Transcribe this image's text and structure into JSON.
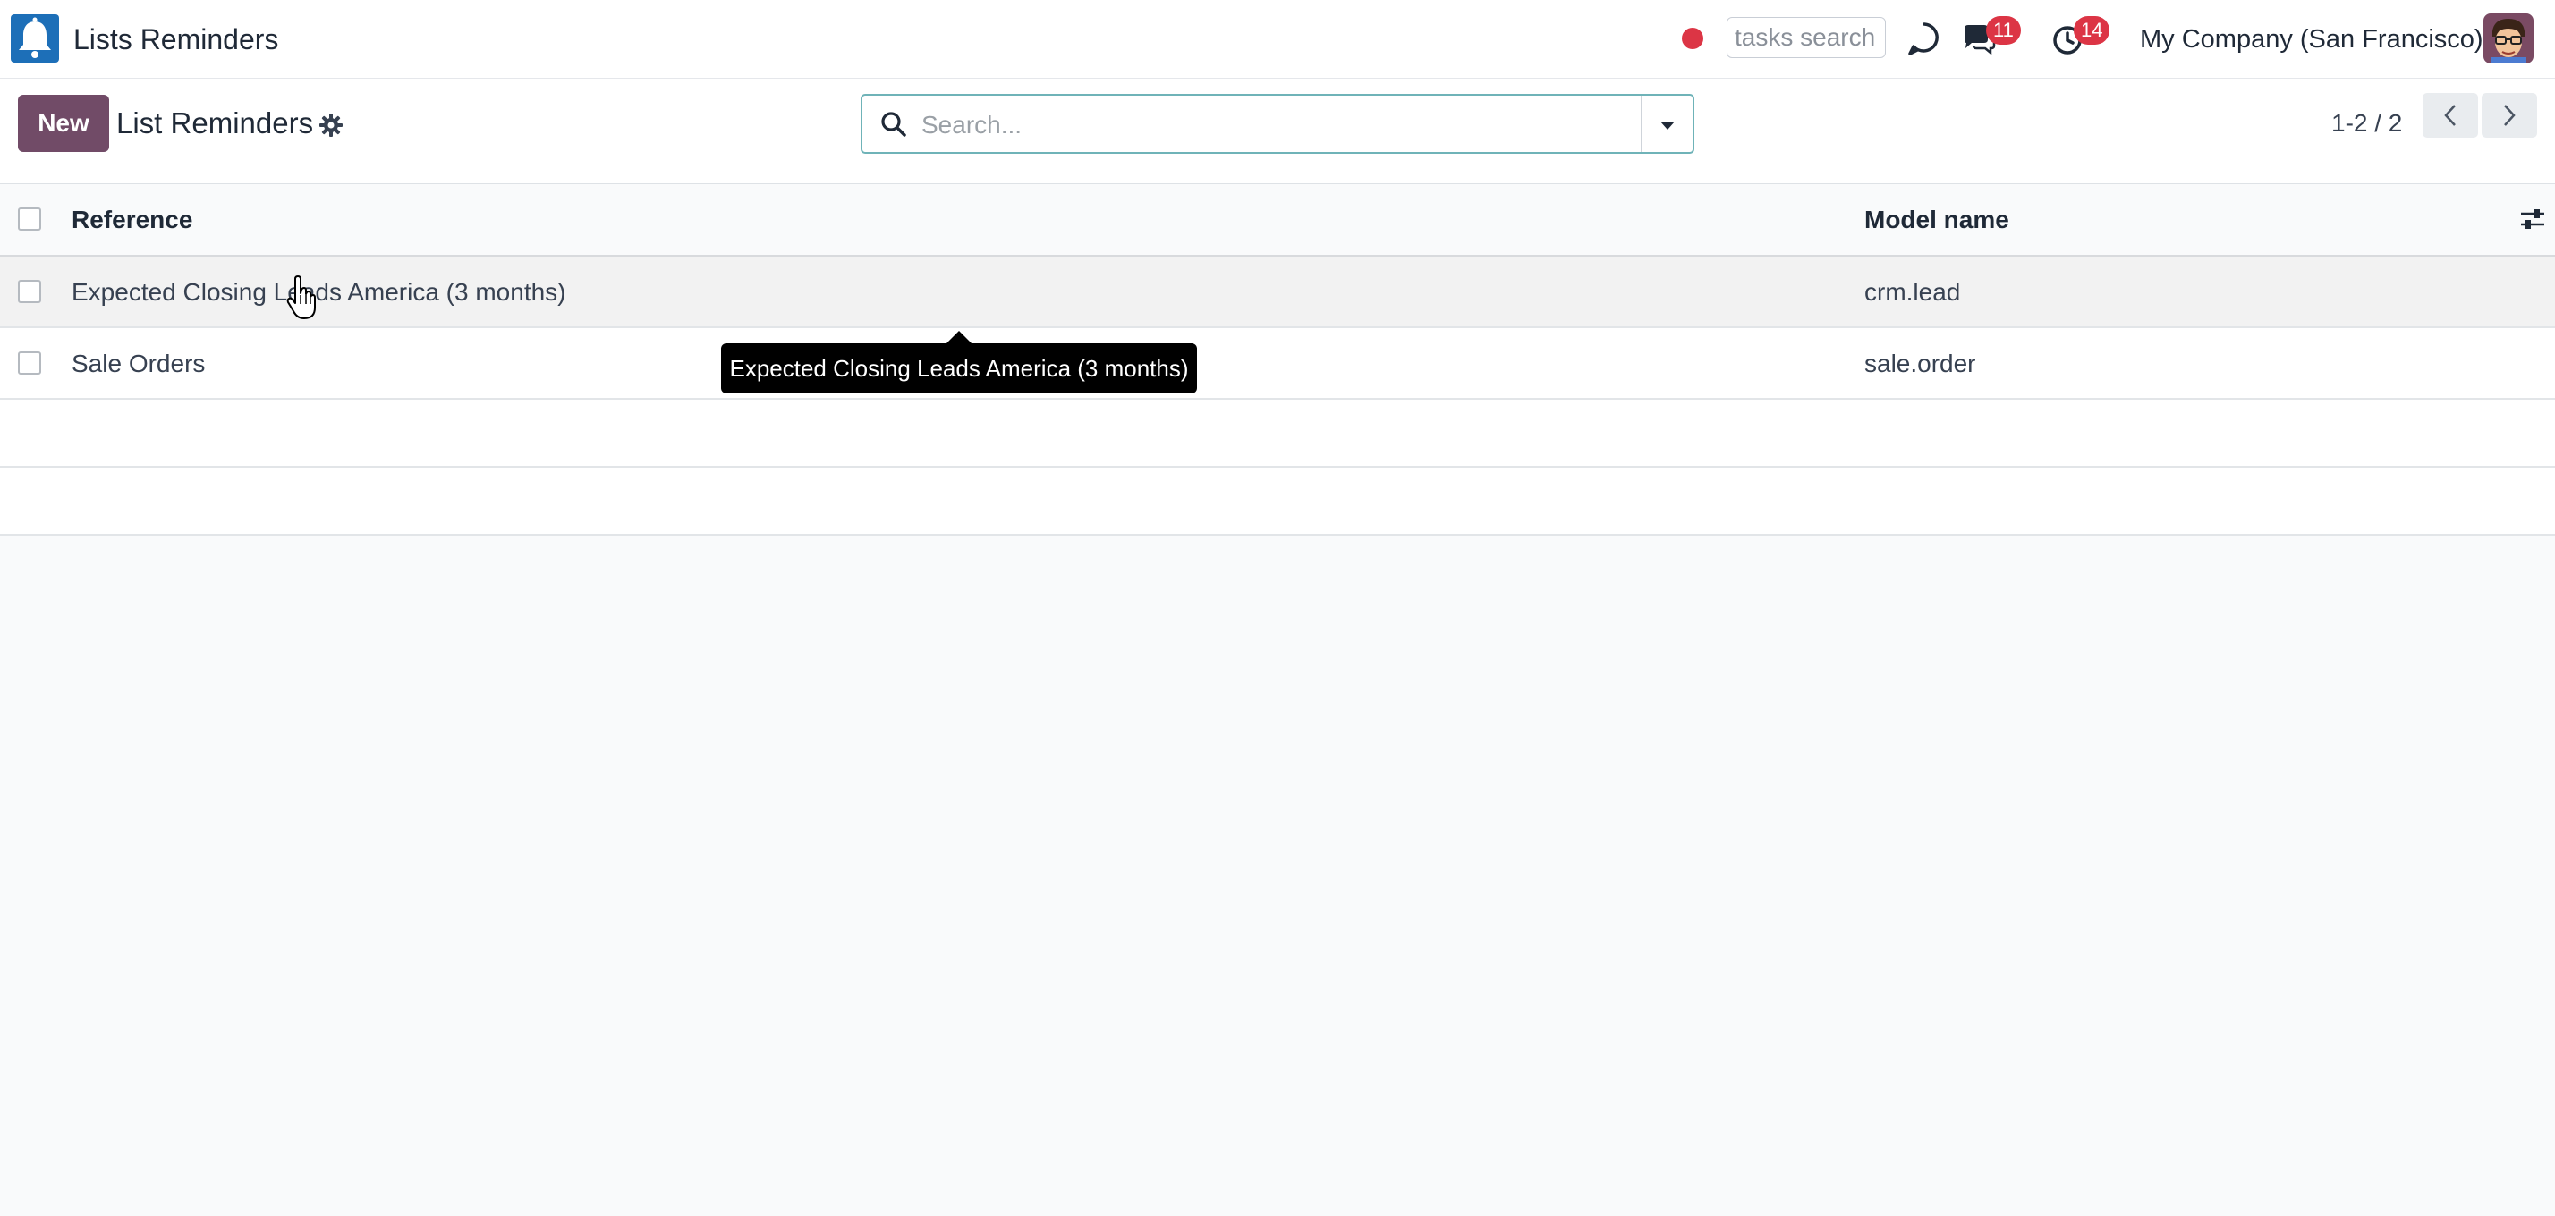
{
  "navbar": {
    "app_title": "Lists Reminders",
    "tasks_search_placeholder": "tasks search",
    "messages_count": "11",
    "activities_count": "14",
    "company": "My Company (San Francisco)"
  },
  "control_panel": {
    "new_label": "New",
    "title": "List Reminders",
    "search_placeholder": "Search...",
    "pager_value": "1-2 / 2"
  },
  "list": {
    "columns": [
      "Reference",
      "Model name"
    ],
    "rows": [
      {
        "reference": "Expected Closing Leads America (3 months)",
        "model_name": "crm.lead"
      },
      {
        "reference": "Sale Orders",
        "model_name": "sale.order"
      }
    ]
  },
  "tooltip": {
    "text": "Expected Closing Leads America (3 months)"
  },
  "colors": {
    "brand": "#714b67",
    "badge": "#dc3545",
    "logo": "#1d6fb8",
    "search_focus": "#6fb3b8"
  },
  "icons": [
    "bell-logo-icon",
    "record-dot-icon",
    "discuss-icon",
    "chat-icon",
    "clock-icon",
    "gear-icon",
    "search-icon",
    "caret-down-icon",
    "chevron-left-icon",
    "chevron-right-icon",
    "column-settings-icon",
    "hand-cursor-icon"
  ]
}
